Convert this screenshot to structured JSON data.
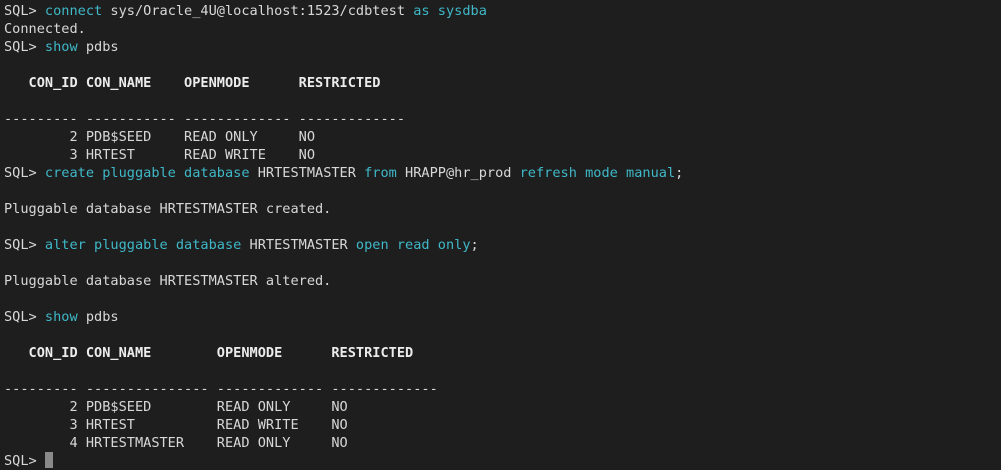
{
  "colors": {
    "background": "#1e1e1e",
    "text": "#d8d8d8",
    "keyword": "#3fb8c8"
  },
  "lines": [
    [
      {
        "t": "SQL> ",
        "c": "prompt"
      },
      {
        "t": "connect",
        "c": "kw"
      },
      {
        "t": " sys/Oracle_4U@localhost:1523/cdbtest ",
        "c": "plain"
      },
      {
        "t": "as sysdba",
        "c": "kw"
      }
    ],
    [
      {
        "t": "Connected.",
        "c": "plain"
      }
    ],
    [
      {
        "t": "SQL> ",
        "c": "prompt"
      },
      {
        "t": "show",
        "c": "kw"
      },
      {
        "t": " pdbs",
        "c": "plain"
      }
    ],
    [
      {
        "t": "",
        "c": "plain"
      }
    ],
    [
      {
        "t": "   CON_ID CON_NAME    OPENMODE      RESTRICTED",
        "c": "hdr"
      }
    ],
    [
      {
        "t": "",
        "c": "plain"
      }
    ],
    [
      {
        "t": "--------- ----------- ------------- -------------",
        "c": "plain"
      }
    ],
    [
      {
        "t": "        2 PDB$SEED    READ ONLY     NO",
        "c": "plain"
      }
    ],
    [
      {
        "t": "        3 HRTEST      READ WRITE    NO",
        "c": "plain"
      }
    ],
    [
      {
        "t": "SQL> ",
        "c": "prompt"
      },
      {
        "t": "create pluggable database",
        "c": "kw"
      },
      {
        "t": " HRTESTMASTER ",
        "c": "plain"
      },
      {
        "t": "from",
        "c": "kw"
      },
      {
        "t": " HRAPP@hr_prod ",
        "c": "plain"
      },
      {
        "t": "refresh mode manual",
        "c": "kw"
      },
      {
        "t": ";",
        "c": "plain"
      }
    ],
    [
      {
        "t": "",
        "c": "plain"
      }
    ],
    [
      {
        "t": "Pluggable database HRTESTMASTER created.",
        "c": "plain"
      }
    ],
    [
      {
        "t": "",
        "c": "plain"
      }
    ],
    [
      {
        "t": "SQL> ",
        "c": "prompt"
      },
      {
        "t": "alter pluggable database",
        "c": "kw"
      },
      {
        "t": " HRTESTMASTER ",
        "c": "plain"
      },
      {
        "t": "open read only",
        "c": "kw"
      },
      {
        "t": ";",
        "c": "plain"
      }
    ],
    [
      {
        "t": "",
        "c": "plain"
      }
    ],
    [
      {
        "t": "Pluggable database HRTESTMASTER altered.",
        "c": "plain"
      }
    ],
    [
      {
        "t": "",
        "c": "plain"
      }
    ],
    [
      {
        "t": "SQL> ",
        "c": "prompt"
      },
      {
        "t": "show",
        "c": "kw"
      },
      {
        "t": " pdbs",
        "c": "plain"
      }
    ],
    [
      {
        "t": "",
        "c": "plain"
      }
    ],
    [
      {
        "t": "   CON_ID CON_NAME        OPENMODE      RESTRICTED",
        "c": "hdr"
      }
    ],
    [
      {
        "t": "",
        "c": "plain"
      }
    ],
    [
      {
        "t": "--------- --------------- ------------- -------------",
        "c": "plain"
      }
    ],
    [
      {
        "t": "        2 PDB$SEED        READ ONLY     NO",
        "c": "plain"
      }
    ],
    [
      {
        "t": "        3 HRTEST          READ WRITE    NO",
        "c": "plain"
      }
    ],
    [
      {
        "t": "        4 HRTESTMASTER    READ ONLY     NO",
        "c": "plain"
      }
    ]
  ],
  "final_prompt": "SQL> "
}
